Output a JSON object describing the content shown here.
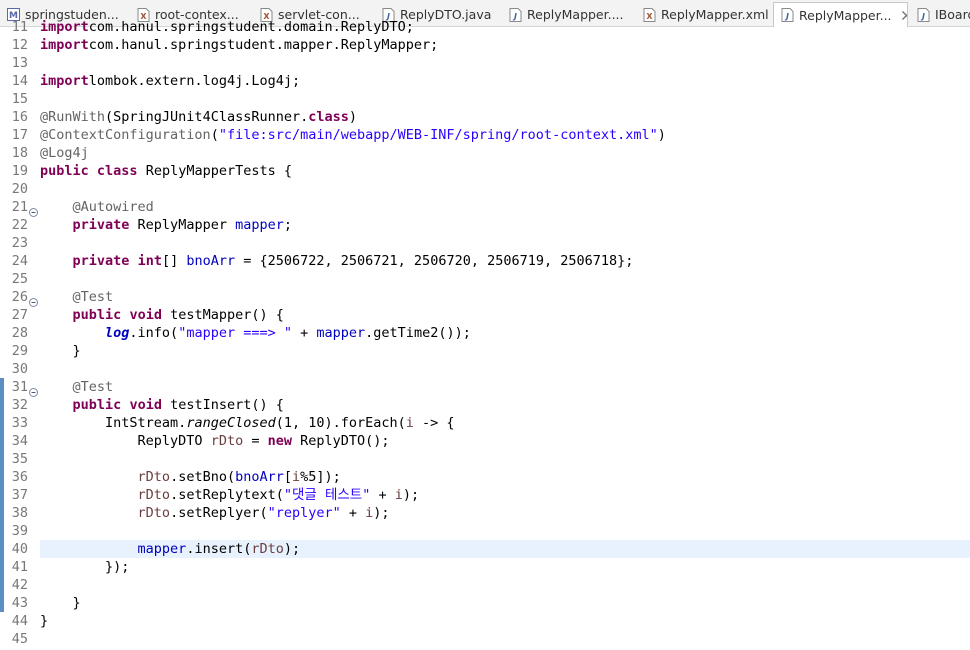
{
  "tabs": [
    {
      "label": "springstuden...",
      "icon": "maven-icon",
      "active": false
    },
    {
      "label": "root-contex...",
      "icon": "xml-icon",
      "active": false
    },
    {
      "label": "servlet-con...",
      "icon": "xml-icon",
      "active": false
    },
    {
      "label": "ReplyDTO.java",
      "icon": "java-file-icon",
      "active": false
    },
    {
      "label": "ReplyMapper....",
      "icon": "java-file-icon",
      "active": false
    },
    {
      "label": "ReplyMapper.xml",
      "icon": "xml-icon",
      "active": false
    },
    {
      "label": "ReplyMapper...",
      "icon": "java-file-icon",
      "active": true
    },
    {
      "label": "IBoardD",
      "icon": "java-file-icon",
      "active": false
    }
  ],
  "editor": {
    "current_line": 40,
    "lines": [
      {
        "n": "11",
        "tokens": [
          [
            "kw",
            "import"
          ],
          [
            "",
            "com.hanul.springstudent.domain.ReplyDTO;"
          ]
        ]
      },
      {
        "n": "12",
        "tokens": [
          [
            "kw",
            "import"
          ],
          [
            "",
            "com.hanul.springstudent.mapper.ReplyMapper;"
          ]
        ]
      },
      {
        "n": "13",
        "tokens": []
      },
      {
        "n": "14",
        "tokens": [
          [
            "kw",
            "import"
          ],
          [
            "",
            "lombok.extern.log4j.Log4j;"
          ]
        ]
      },
      {
        "n": "15",
        "tokens": []
      },
      {
        "n": "16",
        "tokens": [
          [
            "ann",
            "@RunWith"
          ],
          [
            "",
            "(SpringJUnit4ClassRunner."
          ],
          [
            "kw",
            "class"
          ],
          [
            "",
            ")"
          ]
        ]
      },
      {
        "n": "17",
        "tokens": [
          [
            "ann",
            "@ContextConfiguration"
          ],
          [
            "",
            "("
          ],
          [
            "str",
            "\"file:src/main/webapp/WEB-INF/spring/root-context.xml\""
          ],
          [
            "",
            ")"
          ]
        ]
      },
      {
        "n": "18",
        "tokens": [
          [
            "ann",
            "@Log4j"
          ]
        ]
      },
      {
        "n": "19",
        "tokens": [
          [
            "kw",
            "public"
          ],
          [
            "",
            " "
          ],
          [
            "kw",
            "class"
          ],
          [
            "",
            " ReplyMapperTests {"
          ]
        ]
      },
      {
        "n": "20",
        "tokens": []
      },
      {
        "n": "21",
        "fold": true,
        "tokens": [
          [
            "",
            "    "
          ],
          [
            "ann",
            "@Autowired"
          ]
        ]
      },
      {
        "n": "22",
        "tokens": [
          [
            "",
            "    "
          ],
          [
            "kw",
            "private"
          ],
          [
            "",
            " ReplyMapper "
          ],
          [
            "fld",
            "mapper"
          ],
          [
            "",
            ";"
          ]
        ]
      },
      {
        "n": "23",
        "tokens": []
      },
      {
        "n": "24",
        "tokens": [
          [
            "",
            "    "
          ],
          [
            "kw",
            "private"
          ],
          [
            "",
            " "
          ],
          [
            "kw",
            "int"
          ],
          [
            "",
            "[] "
          ],
          [
            "fld",
            "bnoArr"
          ],
          [
            "",
            " = {2506722, 2506721, 2506720, 2506719, 2506718};"
          ]
        ]
      },
      {
        "n": "25",
        "tokens": []
      },
      {
        "n": "26",
        "fold": true,
        "tokens": [
          [
            "",
            "    "
          ],
          [
            "ann",
            "@Test"
          ]
        ]
      },
      {
        "n": "27",
        "tokens": [
          [
            "",
            "    "
          ],
          [
            "kw",
            "public"
          ],
          [
            "",
            " "
          ],
          [
            "kw",
            "void"
          ],
          [
            "",
            " testMapper() {"
          ]
        ]
      },
      {
        "n": "28",
        "tokens": [
          [
            "",
            "        "
          ],
          [
            "sfld",
            "log"
          ],
          [
            "",
            ".info("
          ],
          [
            "str",
            "\"mapper ===> \""
          ],
          [
            "",
            " + "
          ],
          [
            "fld",
            "mapper"
          ],
          [
            "",
            ".getTime2());"
          ]
        ]
      },
      {
        "n": "29",
        "tokens": [
          [
            "",
            "    }"
          ]
        ]
      },
      {
        "n": "30",
        "tokens": []
      },
      {
        "n": "31",
        "fold": true,
        "changed": true,
        "tokens": [
          [
            "",
            "    "
          ],
          [
            "ann",
            "@Test"
          ]
        ]
      },
      {
        "n": "32",
        "changed": true,
        "tokens": [
          [
            "",
            "    "
          ],
          [
            "kw",
            "public"
          ],
          [
            "",
            " "
          ],
          [
            "kw",
            "void"
          ],
          [
            "",
            " testInsert() {"
          ]
        ]
      },
      {
        "n": "33",
        "changed": true,
        "tokens": [
          [
            "",
            "        IntStream."
          ],
          [
            "smeth",
            "rangeClosed"
          ],
          [
            "",
            "(1, 10).forEach("
          ],
          [
            "var",
            "i"
          ],
          [
            "",
            " -> {"
          ]
        ]
      },
      {
        "n": "34",
        "changed": true,
        "tokens": [
          [
            "",
            "            ReplyDTO "
          ],
          [
            "var",
            "rDto"
          ],
          [
            "",
            " = "
          ],
          [
            "kw",
            "new"
          ],
          [
            "",
            " ReplyDTO();"
          ]
        ]
      },
      {
        "n": "35",
        "changed": true,
        "tokens": []
      },
      {
        "n": "36",
        "changed": true,
        "tokens": [
          [
            "",
            "            "
          ],
          [
            "var",
            "rDto"
          ],
          [
            "",
            ".setBno("
          ],
          [
            "fld",
            "bnoArr"
          ],
          [
            "",
            "["
          ],
          [
            "var",
            "i"
          ],
          [
            "",
            "%5]);"
          ]
        ]
      },
      {
        "n": "37",
        "changed": true,
        "tokens": [
          [
            "",
            "            "
          ],
          [
            "var",
            "rDto"
          ],
          [
            "",
            ".setReplytext("
          ],
          [
            "str",
            "\"댓글 테스트\""
          ],
          [
            "",
            " + "
          ],
          [
            "var",
            "i"
          ],
          [
            "",
            ");"
          ]
        ]
      },
      {
        "n": "38",
        "changed": true,
        "tokens": [
          [
            "",
            "            "
          ],
          [
            "var",
            "rDto"
          ],
          [
            "",
            ".setReplyer("
          ],
          [
            "str",
            "\"replyer\""
          ],
          [
            "",
            " + "
          ],
          [
            "var",
            "i"
          ],
          [
            "",
            ");"
          ]
        ]
      },
      {
        "n": "39",
        "changed": true,
        "tokens": []
      },
      {
        "n": "40",
        "changed": true,
        "tokens": [
          [
            "",
            "            "
          ],
          [
            "fld",
            "mapper"
          ],
          [
            "",
            ".insert("
          ],
          [
            "var",
            "rDto"
          ],
          [
            "",
            ");"
          ]
        ]
      },
      {
        "n": "41",
        "changed": true,
        "tokens": [
          [
            "",
            "        });"
          ]
        ]
      },
      {
        "n": "42",
        "changed": true,
        "tokens": []
      },
      {
        "n": "43",
        "changed": true,
        "tokens": [
          [
            "",
            "    }"
          ]
        ]
      },
      {
        "n": "44",
        "tokens": [
          [
            "",
            "}"
          ]
        ]
      },
      {
        "n": "45",
        "tokens": []
      }
    ]
  },
  "colors": {
    "keyword": "#7f0055",
    "annotation": "#646464",
    "string": "#2a00ff",
    "field": "#0000c0",
    "local_variable": "#6a3e3e",
    "line_number": "#787878",
    "current_line_bg": "#e8f2fe",
    "change_bar": "#5b8ec3"
  }
}
